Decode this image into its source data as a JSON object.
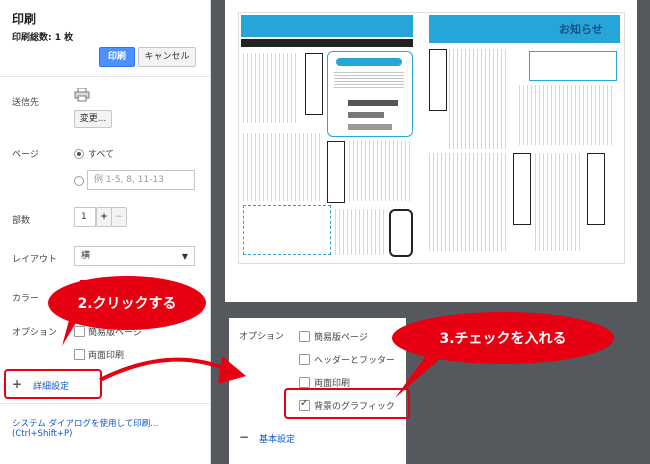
{
  "left_panel": {
    "title": "印刷",
    "total_pages": "印刷総数: 1 枚",
    "print_button": "印刷",
    "cancel_button": "キャンセル",
    "destination_label": "送信先",
    "change_button": "変更...",
    "pages_label": "ページ",
    "pages_all": "すべて",
    "pages_range_placeholder": "例 1-5, 8, 11-13",
    "copies_label": "部数",
    "copies_value": "1",
    "copies_plus": "+",
    "copies_minus": "−",
    "layout_label": "レイアウト",
    "layout_value": "横",
    "color_label": "カラー",
    "options_label": "オプション",
    "option_simple_page": "簡易版ページ",
    "option_duplex": "両面印刷",
    "advanced_settings": "詳細設定",
    "system_dialog": "システム ダイアログを使用して印刷...",
    "system_dialog_shortcut": "(Ctrl+Shift+P)"
  },
  "zoom_panel": {
    "options_label": "オプション",
    "items": [
      {
        "label": "簡易版ページ",
        "checked": false
      },
      {
        "label": "ヘッダーとフッター",
        "checked": false
      },
      {
        "label": "両面印刷",
        "checked": false
      },
      {
        "label": "背景のグラフィック",
        "checked": true
      }
    ],
    "basic_settings": "基本設定"
  },
  "callouts": {
    "step2": "2.クリックする",
    "step3": "3.チェックを入れる"
  },
  "preview": {
    "corner_title": "お知らせ"
  },
  "colors": {
    "accent_blue": "#4d90fe",
    "callout_red": "#e60012",
    "newsletter_blue": "#27a5d8",
    "preview_bg": "#55595d"
  }
}
